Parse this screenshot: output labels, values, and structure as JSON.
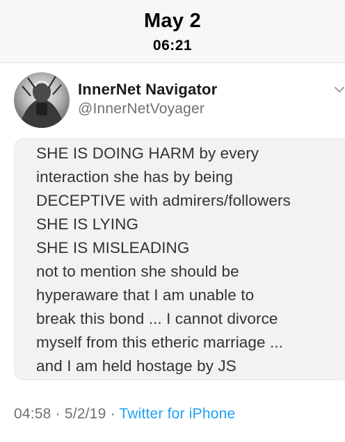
{
  "header": {
    "date": "May 2",
    "time": "06:21"
  },
  "tweet": {
    "author_name": "InnerNet Navigator",
    "author_handle": "@InnerNetVoyager",
    "text_lines": [
      "SHE IS DOING HARM by every",
      "interaction she has by being",
      "DECEPTIVE with admirers/followers",
      "SHE IS LYING",
      "SHE IS MISLEADING",
      "not to mention she should be",
      "hyperaware that I am unable to",
      "break this bond ... I cannot divorce",
      "myself from this etheric marriage ...",
      "and I am held hostage by JS"
    ],
    "timestamp": "04:58",
    "date": "5/2/19",
    "separator": "·",
    "source": "Twitter for iPhone"
  },
  "icons": {
    "avatar": "avatar-image",
    "menu": "chevron-down-icon"
  },
  "colors": {
    "link": "#1da1f2",
    "secondary_text": "#707070",
    "card_background": "#f2f2f2"
  }
}
